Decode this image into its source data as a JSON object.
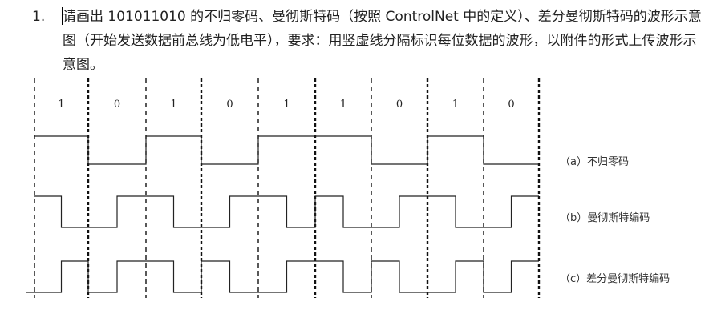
{
  "question": {
    "number": "1.",
    "text": "请画出 101011010 的不归零码、曼彻斯特码（按照 ControlNet 中的定义）、差分曼彻斯特码的波形示意图（开始发送数据前总线为低电平），要求：用竖虚线分隔标识每位数据的波形，以附件的形式上传波形示意图。"
  },
  "figure": {
    "bits": [
      "1",
      "0",
      "1",
      "0",
      "1",
      "1",
      "0",
      "1",
      "0"
    ],
    "captions": {
      "nrz": "（a）不归零码",
      "manchester": "（b）曼彻斯特编码",
      "diff_manchester": "（c）差分曼彻斯特编码"
    }
  }
}
